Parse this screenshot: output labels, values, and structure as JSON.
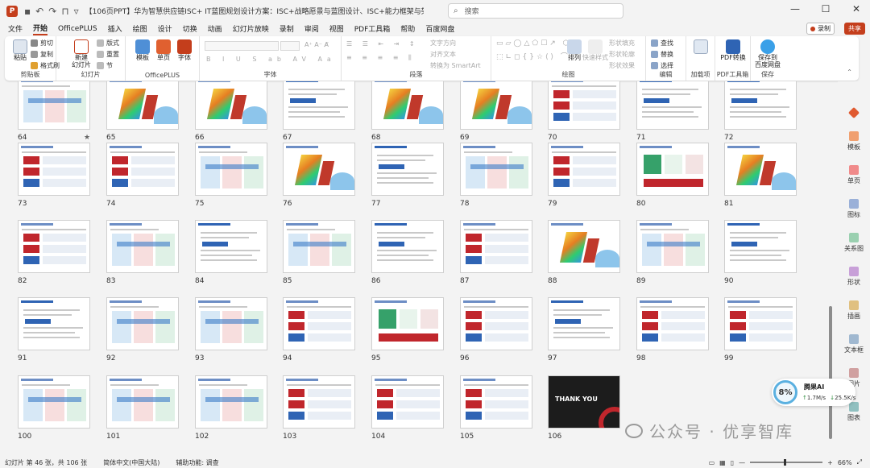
{
  "app": {
    "title": "【106页PPT】华为智慧供应链ISC+ IT蓝图规划设计方案：ISC+战略愿景与蓝图设计、ISC+能力框架与架构设计、实施路径.pptx  -  PowerPo...",
    "search_placeholder": "搜索",
    "record_label": "录制",
    "share_label": "共享"
  },
  "menu_tabs": [
    "文件",
    "开始",
    "OfficePLUS",
    "插入",
    "绘图",
    "设计",
    "切换",
    "动画",
    "幻灯片放映",
    "录制",
    "审阅",
    "视图",
    "PDF工具箱",
    "帮助",
    "百度网盘"
  ],
  "ribbon": {
    "clipboard": {
      "label": "剪贴板",
      "paste": "粘贴",
      "cut": "剪切",
      "copy": "复制",
      "format_painter": "格式刷"
    },
    "slides": {
      "label": "幻灯片",
      "new_slide": "新建\n幻灯片",
      "layout": "版式",
      "reset": "重置",
      "section": "节"
    },
    "officeplus": {
      "label": "OfficePLUS",
      "template": "模板",
      "single_page": "单页",
      "font": "字体"
    },
    "font": {
      "label": "字体"
    },
    "paragraph": {
      "label": "段落",
      "text_direction": "文字方向",
      "align_text": "对齐文本",
      "smartart": "转换为 SmartArt"
    },
    "drawing": {
      "label": "绘图",
      "arrange": "排列",
      "quick_styles": "快速样式",
      "shape_fill": "形状填充",
      "shape_outline": "形状轮廓",
      "shape_effects": "形状效果"
    },
    "editing": {
      "label": "编辑",
      "find": "查找",
      "replace": "替换",
      "select": "选择"
    },
    "addins": {
      "label": "加载项"
    },
    "pdf": {
      "label": "PDF工具箱",
      "pdf_link": "PDF转换"
    },
    "save": {
      "label": "保存",
      "save_baidu": "保存到\n百度网盘"
    }
  },
  "slides": [
    {
      "n": "64",
      "style": "c"
    },
    {
      "n": "65",
      "style": "b"
    },
    {
      "n": "66",
      "style": "b"
    },
    {
      "n": "67",
      "style": "t"
    },
    {
      "n": "68",
      "style": "b"
    },
    {
      "n": "69",
      "style": "b"
    },
    {
      "n": "70",
      "style": "r"
    },
    {
      "n": "71",
      "style": "t"
    },
    {
      "n": "72",
      "style": "t"
    },
    {
      "n": "73",
      "style": "r"
    },
    {
      "n": "74",
      "style": "r"
    },
    {
      "n": "75",
      "style": "c"
    },
    {
      "n": "76",
      "style": "b"
    },
    {
      "n": "77",
      "style": "t"
    },
    {
      "n": "78",
      "style": "c"
    },
    {
      "n": "79",
      "style": "r"
    },
    {
      "n": "80",
      "style": "g"
    },
    {
      "n": "81",
      "style": "b"
    },
    {
      "n": "82",
      "style": "r"
    },
    {
      "n": "83",
      "style": "c"
    },
    {
      "n": "84",
      "style": "t"
    },
    {
      "n": "85",
      "style": "c"
    },
    {
      "n": "86",
      "style": "t"
    },
    {
      "n": "87",
      "style": "r"
    },
    {
      "n": "88",
      "style": "b"
    },
    {
      "n": "89",
      "style": "c"
    },
    {
      "n": "90",
      "style": "t"
    },
    {
      "n": "91",
      "style": "t"
    },
    {
      "n": "92",
      "style": "c"
    },
    {
      "n": "93",
      "style": "c"
    },
    {
      "n": "94",
      "style": "r"
    },
    {
      "n": "95",
      "style": "g"
    },
    {
      "n": "96",
      "style": "r"
    },
    {
      "n": "97",
      "style": "t"
    },
    {
      "n": "98",
      "style": "r"
    },
    {
      "n": "99",
      "style": "r"
    },
    {
      "n": "100",
      "style": "c"
    },
    {
      "n": "101",
      "style": "c"
    },
    {
      "n": "102",
      "style": "c"
    },
    {
      "n": "103",
      "style": "r"
    },
    {
      "n": "104",
      "style": "r"
    },
    {
      "n": "105",
      "style": "r"
    },
    {
      "n": "106",
      "style": "thanks"
    }
  ],
  "thanks_text": "THANK YOU",
  "star_marker": "★",
  "side_pane": [
    "模板",
    "单页",
    "图标",
    "关系图",
    "形状",
    "插画",
    "文本框",
    "图片",
    "图表"
  ],
  "ai_widget": {
    "percent": "8%",
    "name": "腾果AI",
    "up": "1.7M/s",
    "down": "25.5K/s"
  },
  "watermark": "公众号 · 优享智库",
  "status": {
    "slide_info": "幻灯片 第 46 张，共 106 张",
    "language": "简体中文(中国大陆)",
    "accessibility": "辅助功能: 调查",
    "zoom": "66%"
  },
  "colors": {
    "accent": "#c43e1c",
    "blue": "#2f64b4",
    "red": "#c0262c"
  }
}
